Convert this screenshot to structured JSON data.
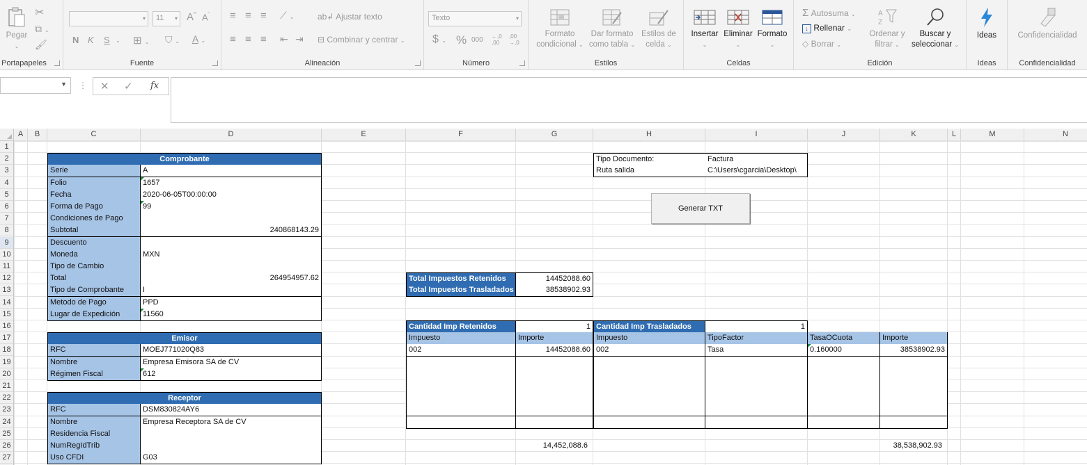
{
  "ribbon": {
    "groups": {
      "clipboard": "Portapapeles",
      "font": "Fuente",
      "alignment": "Alineación",
      "number": "Número",
      "styles": "Estilos",
      "cells": "Celdas",
      "editing": "Edición",
      "ideas": "Ideas",
      "confidentiality": "Confidencialidad"
    },
    "paste": "Pegar",
    "font_size": "11",
    "bold": "N",
    "italic": "K",
    "underline": "S",
    "wrap_text": "Ajustar texto",
    "merge_center": "Combinar y centrar",
    "number_format": "Texto",
    "currency": "$",
    "percent": "%",
    "thousands": "000",
    "inc_decimal": "←,0 ,00",
    "dec_decimal": ",00 →,0",
    "cond_format": [
      "Formato",
      "condicional"
    ],
    "format_table": [
      "Dar formato",
      "como tabla"
    ],
    "cell_styles": [
      "Estilos de",
      "celda"
    ],
    "insert": "Insertar",
    "delete": "Eliminar",
    "format": "Formato",
    "autosum": "Autosuma",
    "fill": "Rellenar",
    "clear": "Borrar",
    "sort_filter": [
      "Ordenar y",
      "filtrar"
    ],
    "find_select": [
      "Buscar y",
      "seleccionar"
    ],
    "ideas_btn": "Ideas",
    "confidentiality_btn": "Confidencialidad"
  },
  "formula_bar": {
    "name_box": "",
    "formula": "",
    "fx": "fx"
  },
  "columns": [
    "A",
    "B",
    "C",
    "D",
    "E",
    "F",
    "G",
    "H",
    "I",
    "J",
    "K",
    "L",
    "M",
    "N"
  ],
  "rows": [
    "1",
    "2",
    "3",
    "4",
    "5",
    "6",
    "7",
    "8",
    "9",
    "10",
    "11",
    "12",
    "13",
    "14",
    "15",
    "16",
    "17",
    "18",
    "19",
    "20",
    "21",
    "22",
    "23",
    "24",
    "25",
    "26",
    "27"
  ],
  "comprobante": {
    "header": "Comprobante",
    "fields": [
      {
        "label": "Serie",
        "value": "A"
      },
      {
        "label": "Folio",
        "value": "1657"
      },
      {
        "label": "Fecha",
        "value": "2020-06-05T00:00:00"
      },
      {
        "label": "Forma de Pago",
        "value": "99"
      },
      {
        "label": "Condiciones de Pago",
        "value": ""
      },
      {
        "label": "Subtotal",
        "value": "240868143.29"
      },
      {
        "label": "Descuento",
        "value": ""
      },
      {
        "label": "Moneda",
        "value": "MXN"
      },
      {
        "label": "Tipo de Cambio",
        "value": ""
      },
      {
        "label": "Total",
        "value": "264954957.62"
      },
      {
        "label": "Tipo de Comprobante",
        "value": "I"
      },
      {
        "label": "Metodo de Pago",
        "value": "PPD"
      },
      {
        "label": "Lugar de Expedición",
        "value": "11560"
      }
    ]
  },
  "emisor": {
    "header": "Emisor",
    "fields": [
      {
        "label": "RFC",
        "value": "MOEJ771020Q83"
      },
      {
        "label": "Nombre",
        "value": "Empresa Emisora SA de CV"
      },
      {
        "label": "Régimen Fiscal",
        "value": "612"
      }
    ]
  },
  "receptor": {
    "header": "Receptor",
    "fields": [
      {
        "label": "RFC",
        "value": "DSM830824AY6"
      },
      {
        "label": "Nombre",
        "value": "Empresa Receptora SA de CV"
      },
      {
        "label": "Residencia Fiscal",
        "value": ""
      },
      {
        "label": "NumRegIdTrib",
        "value": ""
      },
      {
        "label": "Uso CFDI",
        "value": "G03"
      }
    ]
  },
  "doc": {
    "tipo_label": "Tipo Documento:",
    "tipo_value": "Factura",
    "ruta_label": "Ruta salida",
    "ruta_value": "C:\\Users\\cgarcia\\Desktop\\"
  },
  "generate_button": "Generar TXT",
  "totales": {
    "retenidos_label": "Total Impuestos Retenidos",
    "retenidos_value": "14452088.60",
    "trasladados_label": "Total Impuestos Trasladados",
    "trasladados_value": "38538902.93"
  },
  "retenidos": {
    "count_label": "Cantidad Imp Retenidos",
    "count_value": "1",
    "col_impuesto": "Impuesto",
    "col_importe": "Importe",
    "rows": [
      {
        "impuesto": "002",
        "importe": "14452088.60"
      }
    ],
    "sum": "14,452,088.6"
  },
  "trasladados": {
    "count_label": "Cantidad Imp Trasladados",
    "count_value": "1",
    "col_impuesto": "Impuesto",
    "col_tipofactor": "TipoFactor",
    "col_tasa": "TasaOCuota",
    "col_importe": "Importe",
    "rows": [
      {
        "impuesto": "002",
        "tipofactor": "Tasa",
        "tasa": "0.160000",
        "importe": "38538902.93"
      }
    ],
    "sum": "38,538,902.93"
  }
}
